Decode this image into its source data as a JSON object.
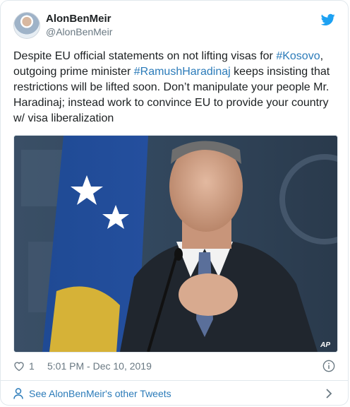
{
  "author": {
    "display_name": "AlonBenMeir",
    "handle": "@AlonBenMeir"
  },
  "tweet": {
    "text_1": "Despite EU official statements on not lifting visas for ",
    "hashtag_1": "#Kosovo",
    "text_2": ", outgoing prime minister ",
    "hashtag_2": "#RamushHaradinaj",
    "text_3": " keeps insisting that restrictions will be lifted soon. Don’t manipulate your people Mr. Haradinaj; instead work to convince EU to provide your country w/ visa liberalization"
  },
  "media": {
    "credit": "AP"
  },
  "meta": {
    "like_count": "1",
    "timestamp": "5:01 PM - Dec 10, 2019"
  },
  "footer": {
    "link_label": "See AlonBenMeir's other Tweets"
  },
  "icons": {
    "brand": "twitter-bird-icon",
    "like": "heart-icon",
    "info": "info-icon",
    "profile": "person-icon",
    "more": "chevron-right-icon"
  },
  "colors": {
    "brand_blue": "#1da1f2",
    "link_blue": "#2b7bb9",
    "meta_gray": "#697882",
    "border": "#e1e8ed"
  }
}
